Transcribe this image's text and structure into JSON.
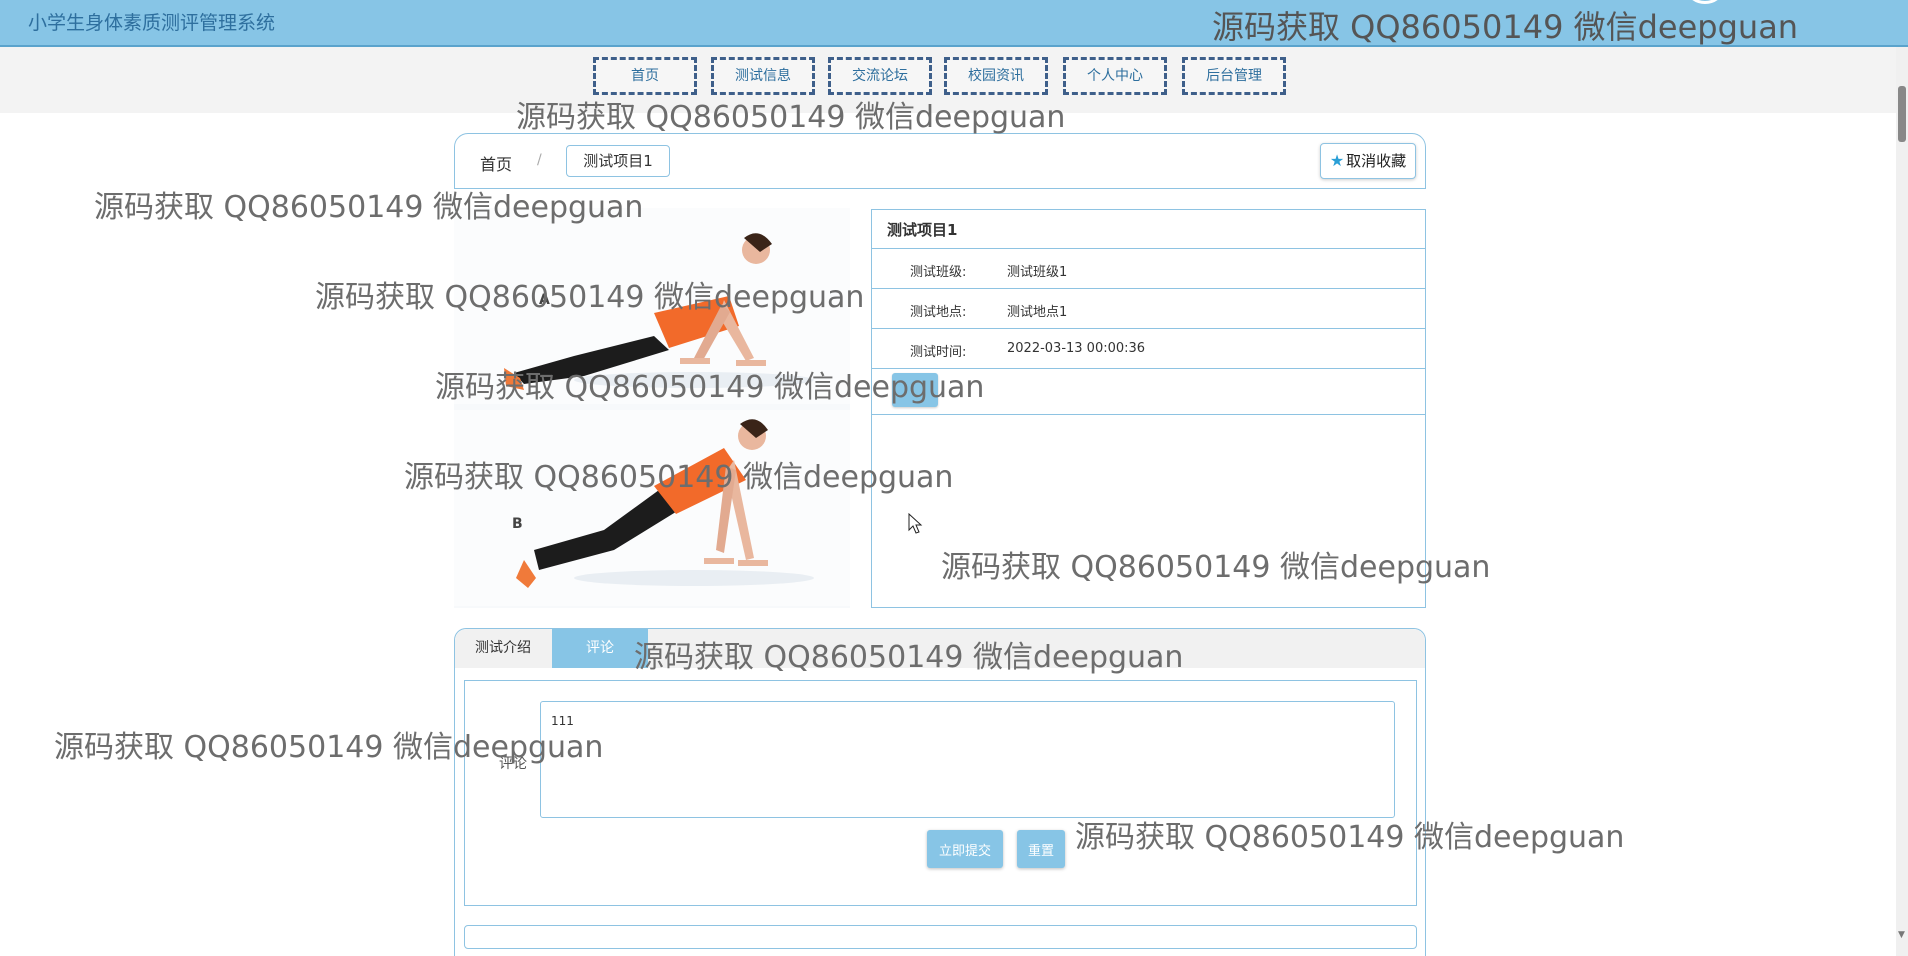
{
  "app": {
    "title": "小学生身体素质测评管理系统"
  },
  "nav": [
    {
      "label": "首页"
    },
    {
      "label": "测试信息"
    },
    {
      "label": "交流论坛"
    },
    {
      "label": "校园资讯"
    },
    {
      "label": "个人中心"
    },
    {
      "label": "后台管理"
    }
  ],
  "breadcrumb": {
    "home": "首页",
    "separator": "/",
    "current": "测试项目1"
  },
  "favorite_button": {
    "label": "取消收藏",
    "icon": "star-icon"
  },
  "images": [
    {
      "label": "A"
    },
    {
      "label": "B"
    }
  ],
  "detail": {
    "title": "测试项目1",
    "fields": [
      {
        "label": "测试班级:",
        "value": "测试班级1"
      },
      {
        "label": "测试地点:",
        "value": "测试地点1"
      },
      {
        "label": "测试时间:",
        "value": "2022-03-13 00:00:36"
      }
    ]
  },
  "tabs": [
    {
      "label": "测试介绍"
    },
    {
      "label": "评论"
    }
  ],
  "comment_form": {
    "label": "评论",
    "value": "111",
    "submit": "立即提交",
    "reset": "重置"
  },
  "watermark": {
    "text": "源码获取 QQ86050149 微信deepguan"
  },
  "colors": {
    "accent": "#87c5e6",
    "border": "#8ec3e2",
    "nav_border": "#3e5f8a"
  }
}
